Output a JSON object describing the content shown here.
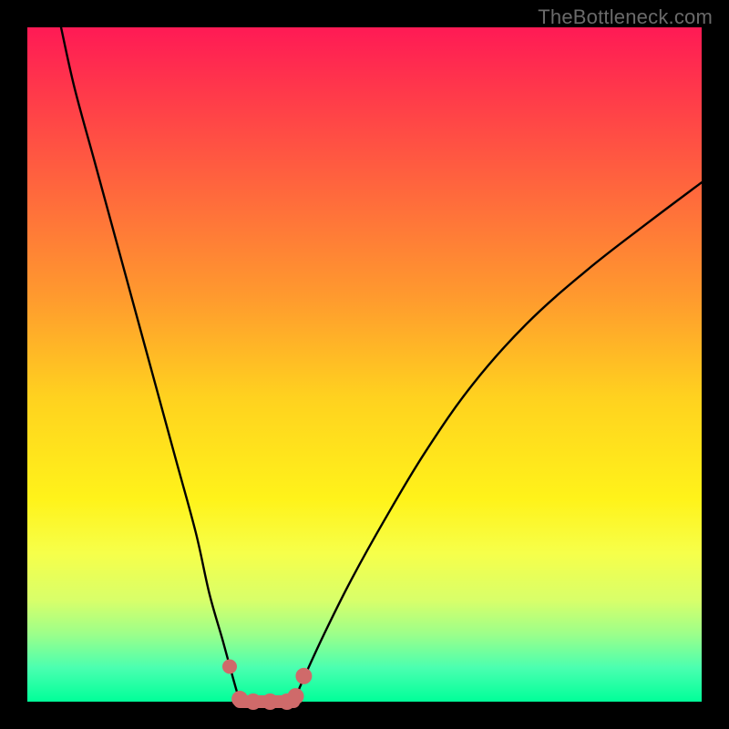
{
  "watermark": "TheBottleneck.com",
  "chart_data": {
    "type": "line",
    "title": "",
    "xlabel": "",
    "ylabel": "",
    "xlim": [
      0,
      1
    ],
    "ylim": [
      0,
      1
    ],
    "series": [
      {
        "name": "curve-left",
        "x": [
          0.05,
          0.07,
          0.1,
          0.13,
          0.16,
          0.19,
          0.22,
          0.25,
          0.27,
          0.29,
          0.305,
          0.315
        ],
        "y": [
          1.0,
          0.91,
          0.8,
          0.69,
          0.58,
          0.47,
          0.36,
          0.25,
          0.16,
          0.09,
          0.035,
          0.0
        ]
      },
      {
        "name": "curve-right",
        "x": [
          0.395,
          0.41,
          0.44,
          0.48,
          0.53,
          0.59,
          0.66,
          0.74,
          0.83,
          0.92,
          1.0
        ],
        "y": [
          0.0,
          0.035,
          0.1,
          0.18,
          0.27,
          0.37,
          0.47,
          0.56,
          0.64,
          0.71,
          0.77
        ]
      },
      {
        "name": "flat-bottom",
        "x": [
          0.315,
          0.33,
          0.36,
          0.385,
          0.395
        ],
        "y": [
          0.0,
          0.0,
          0.0,
          0.0,
          0.0
        ]
      }
    ],
    "markers": [
      {
        "name": "dot-left",
        "x": 0.3,
        "y": 0.052,
        "r": 8
      },
      {
        "name": "flat-start",
        "x": 0.315,
        "y": 0.004,
        "r": 9
      },
      {
        "name": "flat-a",
        "x": 0.335,
        "y": 0.0,
        "r": 9
      },
      {
        "name": "flat-b",
        "x": 0.36,
        "y": 0.0,
        "r": 9
      },
      {
        "name": "flat-c",
        "x": 0.385,
        "y": 0.0,
        "r": 9
      },
      {
        "name": "flat-end",
        "x": 0.398,
        "y": 0.008,
        "r": 9
      },
      {
        "name": "dot-right-upper",
        "x": 0.41,
        "y": 0.038,
        "r": 9
      }
    ],
    "colors": {
      "curve": "#000000",
      "marker": "#cf6a6a"
    }
  }
}
